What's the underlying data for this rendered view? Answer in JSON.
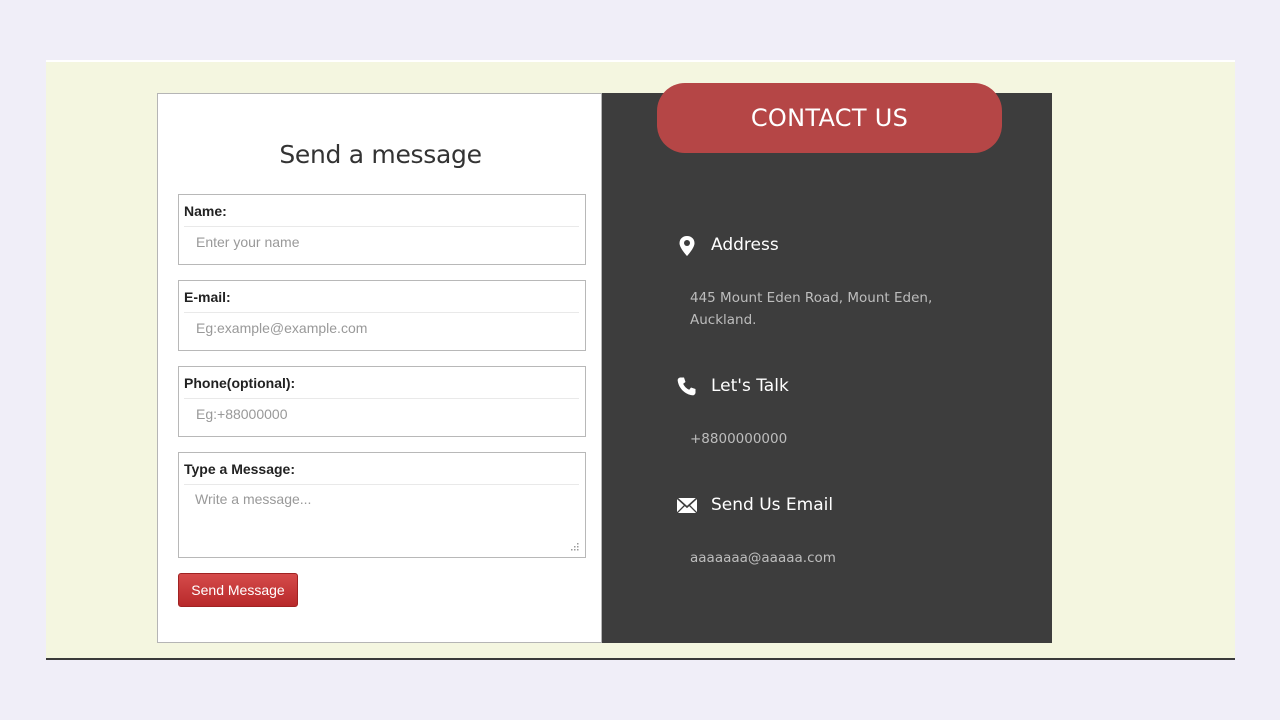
{
  "form": {
    "title": "Send a message",
    "fields": [
      {
        "label": "Name:",
        "placeholder": "Enter your name",
        "value": ""
      },
      {
        "label": "E-mail:",
        "placeholder": "Eg:example@example.com",
        "value": ""
      },
      {
        "label": "Phone(optional):",
        "placeholder": "Eg:+88000000",
        "value": ""
      },
      {
        "label": "Type a Message:",
        "placeholder": "Write a message...",
        "value": ""
      }
    ],
    "submit_label": "Send Message"
  },
  "contact": {
    "badge": "CONTACT US",
    "address": {
      "icon": "map-pin-icon",
      "heading": "Address",
      "line1": "445 Mount Eden Road, Mount Eden,",
      "line2": "Auckland."
    },
    "phone": {
      "icon": "phone-icon",
      "heading": "Let's Talk",
      "text": "+8800000000"
    },
    "email": {
      "icon": "envelope-icon",
      "heading": "Send Us Email",
      "text": "aaaaaaa@aaaaa.com"
    }
  },
  "colors": {
    "accent_red": "#b54646",
    "button_red": "#c9393a",
    "panel_dark": "#3d3d3d",
    "page_bg": "#f0eef8",
    "section_bg": "#f4f6e0"
  }
}
